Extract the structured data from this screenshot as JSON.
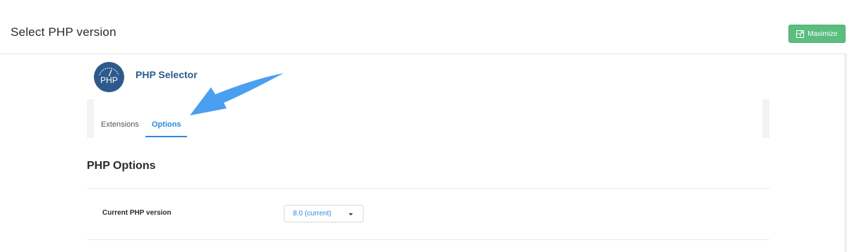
{
  "header": {
    "title": "Select PHP version",
    "maximize_label": "Maximize",
    "maximize_icon": "expand-icon",
    "accent_color": "#5bbd7e"
  },
  "selector": {
    "logo_text": "PHP",
    "title": "PHP Selector",
    "logo_color": "#2c5a8c"
  },
  "tabs": [
    {
      "label": "Extensions",
      "active": false
    },
    {
      "label": "Options",
      "active": true
    }
  ],
  "tab_accent_color": "#2f88d8",
  "options": {
    "section_title": "PHP Options",
    "rows": [
      {
        "label": "Current PHP version",
        "value": "8.0 (current)"
      }
    ]
  },
  "annotation": {
    "icon": "arrow-pointer-icon",
    "color": "#4a9ff0"
  }
}
